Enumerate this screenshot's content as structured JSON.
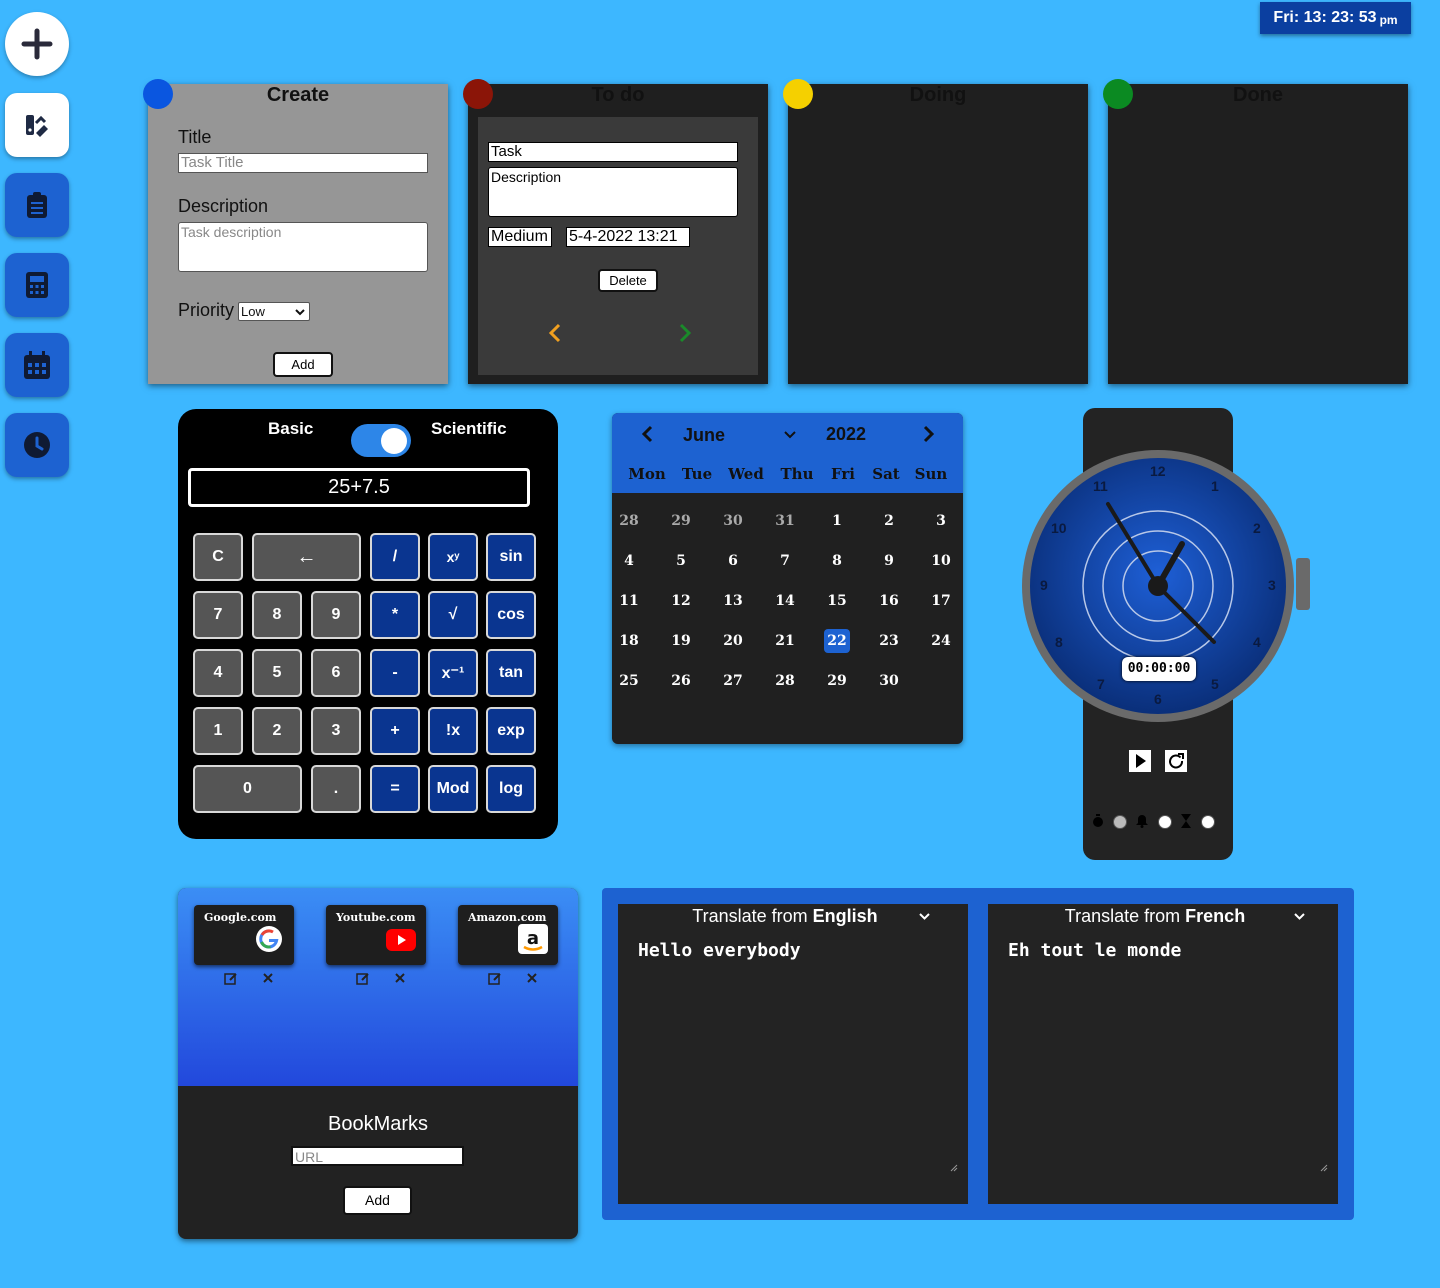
{
  "clock": {
    "time": "Fri: 13: 23: 53",
    "ampm": "pm"
  },
  "kanban": {
    "create": {
      "title": "Create",
      "title_label": "Title",
      "title_placeholder": "Task Title",
      "desc_label": "Description",
      "desc_placeholder": "Task description",
      "priority_label": "Priority",
      "priority_value": "Low",
      "add_label": "Add",
      "color": "#0a56e0"
    },
    "todo": {
      "title": "To do",
      "color": "#8b1508",
      "task": {
        "title": "Task",
        "description": "Description",
        "priority": "Medium",
        "date": "5-4-2022 13:21",
        "delete_label": "Delete"
      }
    },
    "doing": {
      "title": "Doing",
      "color": "#f5d000"
    },
    "done": {
      "title": "Done",
      "color": "#0b8a22"
    }
  },
  "calculator": {
    "mode_left": "Basic",
    "mode_right": "Scientific",
    "display": "25+7.5",
    "keys": {
      "c": "C",
      "back": "←",
      "div": "/",
      "pow": "xʸ",
      "sin": "sin",
      "k7": "7",
      "k8": "8",
      "k9": "9",
      "mul": "*",
      "sqrt": "√",
      "cos": "cos",
      "k4": "4",
      "k5": "5",
      "k6": "6",
      "sub": "-",
      "inv": "x⁻¹",
      "tan": "tan",
      "k1": "1",
      "k2": "2",
      "k3": "3",
      "add": "+",
      "fact": "!x",
      "exp": "exp",
      "k0": "0",
      "dot": ".",
      "eq": "=",
      "mod": "Mod",
      "log": "log"
    }
  },
  "calendar": {
    "month": "June",
    "year": "2022",
    "weekdays": [
      "Mon",
      "Tue",
      "Wed",
      "Thu",
      "Fri",
      "Sat",
      "Sun"
    ],
    "days": [
      "28",
      "29",
      "30",
      "31",
      "1",
      "2",
      "3",
      "4",
      "5",
      "6",
      "7",
      "8",
      "9",
      "10",
      "11",
      "12",
      "13",
      "14",
      "15",
      "16",
      "17",
      "18",
      "19",
      "20",
      "21",
      "22",
      "23",
      "24",
      "25",
      "26",
      "27",
      "28",
      "29",
      "30"
    ],
    "selected": "22"
  },
  "watch": {
    "numbers": [
      "12",
      "1",
      "2",
      "3",
      "4",
      "5",
      "6",
      "7",
      "8",
      "9",
      "10",
      "11"
    ],
    "stopwatch": "00:00:00"
  },
  "bookmarks": {
    "title": "BookMarks",
    "url_placeholder": "URL",
    "add_label": "Add",
    "items": [
      {
        "name": "Google.com"
      },
      {
        "name": "Youtube.com"
      },
      {
        "name": "Amazon.com"
      }
    ]
  },
  "translator": {
    "left": {
      "prefix": "Translate from",
      "lang": "English",
      "text": "Hello everybody"
    },
    "right": {
      "prefix": "Translate from",
      "lang": "French",
      "text": "Eh tout le monde"
    }
  }
}
